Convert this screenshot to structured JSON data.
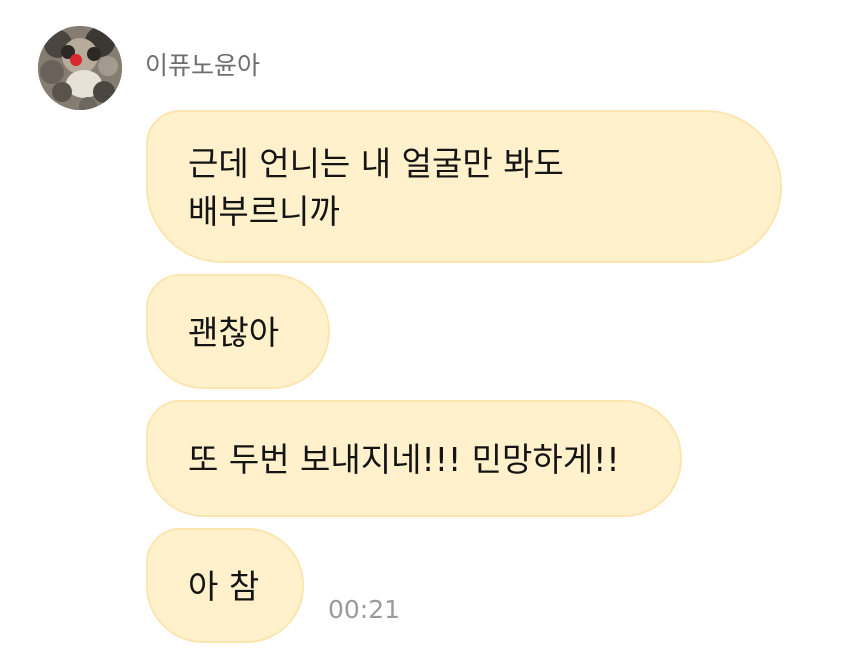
{
  "chat": {
    "sender_name": "이퓨노윤아",
    "messages": [
      {
        "text": "근데 언니는 내 얼굴만 봐도\n배부르니까"
      },
      {
        "text": "괜찮아"
      },
      {
        "text": "또 두번 보내지네!!! 민망하게!!"
      },
      {
        "text": "아 참"
      }
    ],
    "timestamp": "00:21"
  },
  "colors": {
    "bubble_bg": "#fff1cc",
    "bubble_border": "#fbe6b0",
    "sender_text": "#6e6e6e",
    "timestamp_text": "#9a9a9a"
  },
  "icons": {
    "avatar": "profile-photo-icon"
  }
}
